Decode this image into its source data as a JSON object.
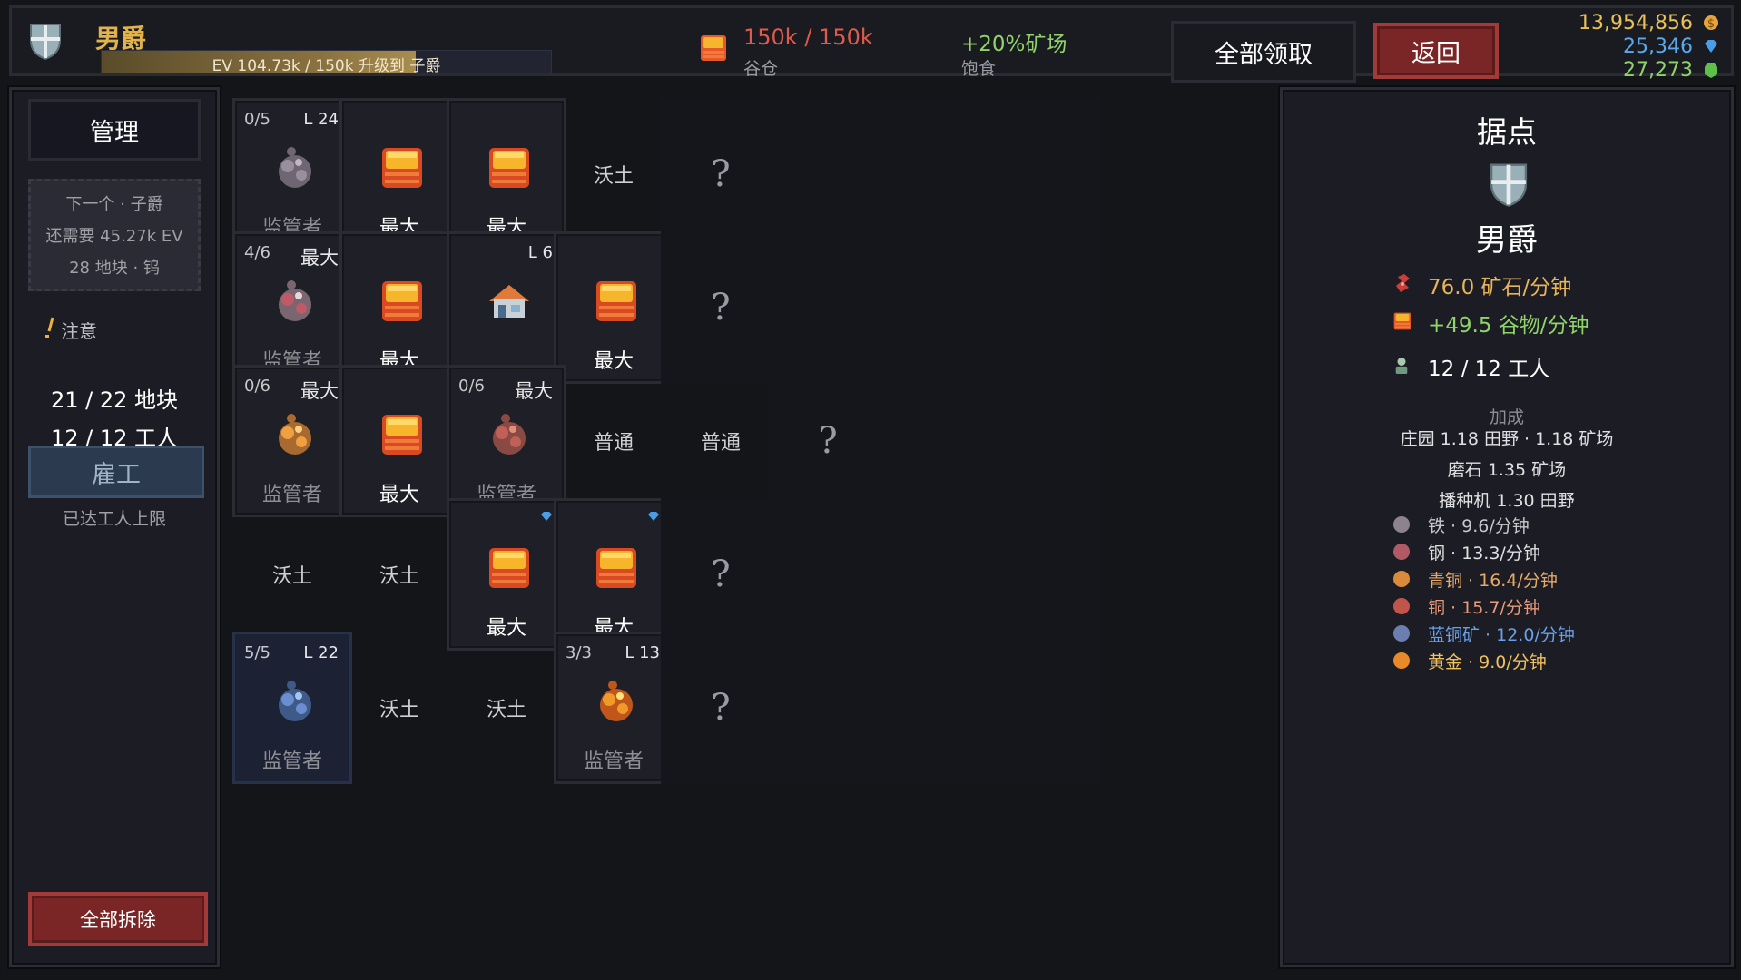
{
  "header": {
    "rank": "男爵",
    "ev_text": "EV 104.73k / 150k 升级到 子爵",
    "ev_progress": 0.698,
    "granary_value": "150k / 150k",
    "granary_label": "谷仓",
    "boost_value": "+20%矿场",
    "boost_label": "饱食",
    "claim_all": "全部领取",
    "back": "返回",
    "currencies": [
      {
        "value": "13,954,856",
        "color": "#e8c15a",
        "icon": "coin-icon"
      },
      {
        "value": "25,346",
        "color": "#5aa8e8",
        "icon": "diamond-icon"
      },
      {
        "value": "27,273",
        "color": "#8fd36a",
        "icon": "emerald-icon"
      }
    ]
  },
  "left": {
    "manage": "管理",
    "next_lines": [
      "下一个 · 子爵",
      "还需要 45.27k EV",
      "28 地块 · 钨"
    ],
    "note": "注意",
    "plots": "21 / 22 地块",
    "workers": "12 / 12 工人",
    "hire": "雇工",
    "limit": "已达工人上限",
    "demolish_all": "全部拆除"
  },
  "grid": {
    "tiles": [
      {
        "tl": "0/5",
        "tr": "L 24",
        "label": "监管者",
        "icon": "iron-ore-icon"
      },
      {
        "label": "最大",
        "icon": "granary-icon"
      },
      {
        "label": "最大",
        "icon": "granary-icon"
      },
      {
        "center": "沃土"
      },
      {
        "q": "?"
      },
      {},
      {},
      {},
      {
        "tl": "4/6",
        "tr": "最大",
        "label": "监管者",
        "icon": "steel-ore-icon"
      },
      {
        "label": "最大",
        "icon": "granary-icon"
      },
      {
        "tr": "L 6",
        "icon": "house-icon"
      },
      {
        "label": "最大",
        "icon": "granary-icon"
      },
      {
        "q": "?"
      },
      {},
      {},
      {},
      {
        "tl": "0/6",
        "tr": "最大",
        "label": "监管者",
        "icon": "bronze-ore-icon"
      },
      {
        "label": "最大",
        "icon": "granary-icon"
      },
      {
        "tl": "0/6",
        "tr": "最大",
        "label": "监管者",
        "icon": "copper-ore-icon"
      },
      {
        "center": "普通"
      },
      {
        "center": "普通"
      },
      {
        "q": "?"
      },
      {},
      {},
      {
        "center": "沃土"
      },
      {
        "center": "沃土"
      },
      {
        "label": "最大",
        "icon": "granary-icon",
        "gem": true
      },
      {
        "label": "最大",
        "icon": "granary-icon",
        "gem": true
      },
      {
        "q": "?"
      },
      {},
      {},
      {},
      {
        "tl": "5/5",
        "tr": "L 22",
        "label": "监管者",
        "icon": "azurite-ore-icon",
        "blue": true
      },
      {
        "center": "沃土"
      },
      {
        "center": "沃土"
      },
      {
        "tl": "3/3",
        "tr": "L 13",
        "label": "监管者",
        "icon": "gold-ore-icon"
      },
      {
        "q": "?"
      },
      {},
      {},
      {}
    ]
  },
  "right": {
    "title": "据点",
    "rank": "男爵",
    "ore_rate": "76.0 矿石/分钟",
    "grain_rate": "+49.5 谷物/分钟",
    "workers": "12 / 12 工人",
    "bonus_header": "加成",
    "bonus_lines": [
      "庄园 1.18 田野 · 1.18 矿场",
      "磨石 1.35 矿场",
      "播种机 1.30 田野"
    ],
    "ores": [
      {
        "name": "铁 · 9.6/分钟",
        "color": "#c8c8cc",
        "icon": "iron-icon",
        "ic": "#8d8290"
      },
      {
        "name": "钢 · 13.3/分钟",
        "color": "#e0e0e2",
        "icon": "steel-icon",
        "ic": "#b05a66"
      },
      {
        "name": "青铜 · 16.4/分钟",
        "color": "#e8a86a",
        "icon": "bronze-icon",
        "ic": "#d98a3a"
      },
      {
        "name": "铜 · 15.7/分钟",
        "color": "#e89a7a",
        "icon": "copper-icon",
        "ic": "#c0564a"
      },
      {
        "name": "蓝铜矿 · 12.0/分钟",
        "color": "#6aa0e8",
        "icon": "azurite-icon",
        "ic": "#6a7fb0"
      },
      {
        "name": "黄金 · 9.0/分钟",
        "color": "#f0c060",
        "icon": "gold-icon",
        "ic": "#e88a2a"
      }
    ]
  }
}
